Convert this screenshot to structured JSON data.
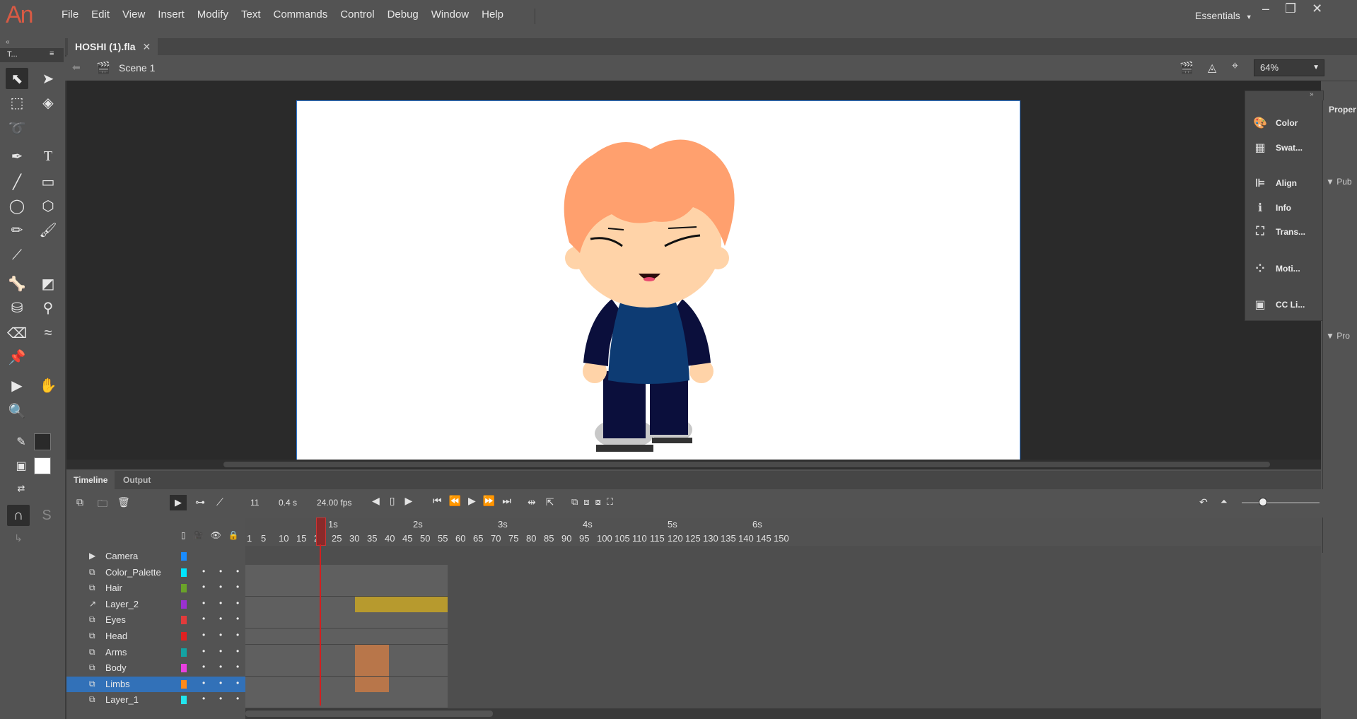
{
  "app": {
    "logo": "An"
  },
  "menu": [
    "File",
    "Edit",
    "View",
    "Insert",
    "Modify",
    "Text",
    "Commands",
    "Control",
    "Debug",
    "Window",
    "Help"
  ],
  "workspace": "Essentials",
  "tools_header": "T...",
  "document": {
    "tab": "HOSHI (1).fla",
    "scene": "Scene 1",
    "zoom": "64%"
  },
  "dock_panels": [
    "Color",
    "Swat...",
    "Align",
    "Info",
    "Trans...",
    "Moti...",
    "CC Li..."
  ],
  "properties": {
    "title": "Proper",
    "sections": [
      "Pub",
      "Pro"
    ]
  },
  "timeline": {
    "tabs": [
      "Timeline",
      "Output"
    ],
    "current_frame": "11",
    "elapsed": "0.4 s",
    "fps": "24.00 fps",
    "seconds_marks": [
      "1s",
      "2s",
      "3s",
      "4s",
      "5s",
      "6s"
    ],
    "frame_numbers": [
      "1",
      "5",
      "10",
      "15",
      "20",
      "25",
      "30",
      "35",
      "40",
      "45",
      "50",
      "55",
      "60",
      "65",
      "70",
      "75",
      "80",
      "85",
      "90",
      "95",
      "100",
      "105",
      "110",
      "115",
      "120",
      "125",
      "130",
      "135",
      "140",
      "145",
      "150"
    ],
    "layers": [
      {
        "name": "Camera",
        "color": "#1a8cff",
        "type": "camera"
      },
      {
        "name": "Color_Palette",
        "color": "#00e5ff",
        "type": "normal"
      },
      {
        "name": "Hair",
        "color": "#6aa329",
        "type": "normal"
      },
      {
        "name": "Layer_2",
        "color": "#9b30d0",
        "type": "guide"
      },
      {
        "name": "Eyes",
        "color": "#e23b3b",
        "type": "normal"
      },
      {
        "name": "Head",
        "color": "#e02020",
        "type": "normal"
      },
      {
        "name": "Arms",
        "color": "#13a3a3",
        "type": "normal"
      },
      {
        "name": "Body",
        "color": "#ea3fe0",
        "type": "normal"
      },
      {
        "name": "Limbs",
        "color": "#ff8a1a",
        "type": "normal",
        "selected": true
      },
      {
        "name": "Layer_1",
        "color": "#22e5ee",
        "type": "normal"
      }
    ]
  },
  "colors": {
    "stage": "#ffffff",
    "hair": "#ffa06e",
    "skin": "#ffd3a8",
    "shirt": "#0d3b73",
    "pants": "#0b0f3c",
    "shoe": "#c8c8c8"
  }
}
